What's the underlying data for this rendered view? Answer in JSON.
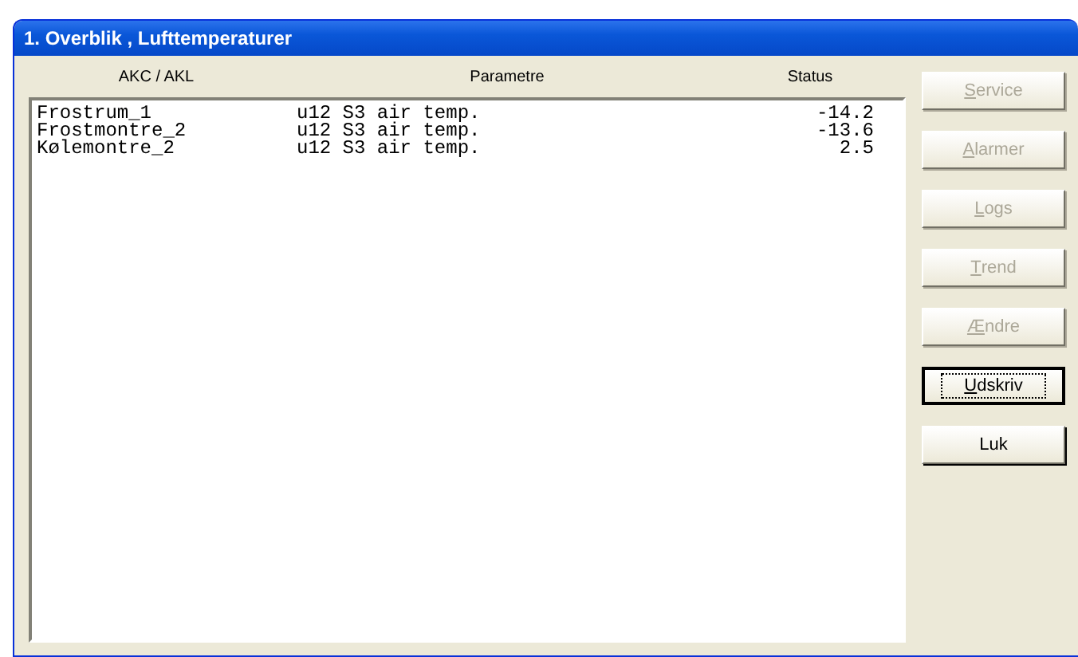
{
  "window": {
    "title": "1. Overblik , Lufttemperaturer"
  },
  "table": {
    "columns": [
      "AKC / AKL",
      "Parametre",
      "Status"
    ],
    "rows": [
      {
        "cells": [
          "Frostrum_1",
          "u12 S3 air temp.",
          "-14.2"
        ]
      },
      {
        "cells": [
          "Frostmontre_2",
          "u12 S3 air temp.",
          "-13.6"
        ]
      },
      {
        "cells": [
          "Kølemontre_2",
          "u12 S3 air temp.",
          "2.5"
        ]
      }
    ]
  },
  "buttons": [
    {
      "label": "Service",
      "disabled": true,
      "default": false,
      "mnemonic": true
    },
    {
      "label": "Alarmer",
      "disabled": true,
      "default": false,
      "mnemonic": true
    },
    {
      "label": "Logs",
      "disabled": true,
      "default": false,
      "mnemonic": true
    },
    {
      "label": "Trend",
      "disabled": true,
      "default": false,
      "mnemonic": true
    },
    {
      "label": "Ændre",
      "disabled": true,
      "default": false,
      "mnemonic": true
    },
    {
      "label": "Udskriv",
      "disabled": false,
      "default": true,
      "mnemonic": true
    },
    {
      "label": "Luk",
      "disabled": false,
      "default": false,
      "mnemonic": false
    }
  ]
}
